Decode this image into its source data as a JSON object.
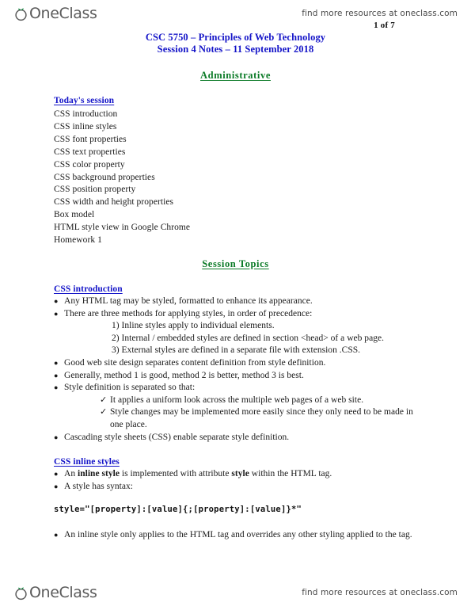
{
  "header": {
    "logo_text": "OneClass",
    "logo_icon": "oneclass-sprout-logo",
    "resources_text": "find more resources at oneclass.com",
    "page_number": "1 of 7"
  },
  "footer": {
    "logo_text": "OneClass",
    "logo_icon": "oneclass-sprout-logo",
    "resources_text": "find more resources at oneclass.com"
  },
  "document": {
    "title_line_1": "CSC 5750 – Principles of Web Technology",
    "title_line_2": "Session 4 Notes – 11 September 2018",
    "title_color": "#1414c8",
    "heading_color": "#0a7a26",
    "section_heading_color": "#1414c8"
  },
  "sections": {
    "administrative": {
      "heading": "Administrative",
      "today_heading": "Today's session",
      "today_items": [
        "CSS introduction",
        "CSS inline styles",
        "CSS font properties",
        "CSS text properties",
        "CSS color property",
        "CSS background properties",
        "CSS position property",
        "CSS width and height properties",
        "Box model",
        "HTML style view in Google Chrome",
        "Homework 1"
      ]
    },
    "session_topics": {
      "heading": "Session Topics",
      "css_introduction": {
        "heading": "CSS introduction",
        "bullets": [
          "Any HTML tag may be styled, formatted to enhance its appearance.",
          "There are three methods for applying styles, in order of precedence:"
        ],
        "numbered": [
          "1) Inline styles apply to individual elements.",
          "2) Internal / embedded styles are defined in section <head> of a web page.",
          "3) External styles are defined in a separate file with extension .CSS."
        ],
        "bullets_2": [
          "Good web site design separates content definition from style definition.",
          "Generally, method 1 is good, method 2 is better, method 3 is best.",
          "Style definition is separated so that:"
        ],
        "checks": [
          "It applies a uniform look across the multiple web pages of a web site.",
          "Style changes may be implemented more easily since they only need to be made in one place."
        ],
        "bullets_3": [
          "Cascading style sheets (CSS) enable separate style definition."
        ]
      },
      "css_inline_styles": {
        "heading": "CSS inline styles",
        "bullet_1_pre": "An ",
        "bullet_1_bold_1": "inline style",
        "bullet_1_mid": " is implemented with attribute ",
        "bullet_1_bold_2": "style",
        "bullet_1_post": " within the HTML tag.",
        "bullet_2": "A style has syntax:",
        "code": "style=\"[property]:[value]{;[property]:[value]}*\"",
        "bullet_3": "An inline style only applies to the HTML tag and overrides any other styling applied to the tag."
      }
    }
  },
  "markers": {
    "bullet": "●",
    "check": "✓"
  }
}
